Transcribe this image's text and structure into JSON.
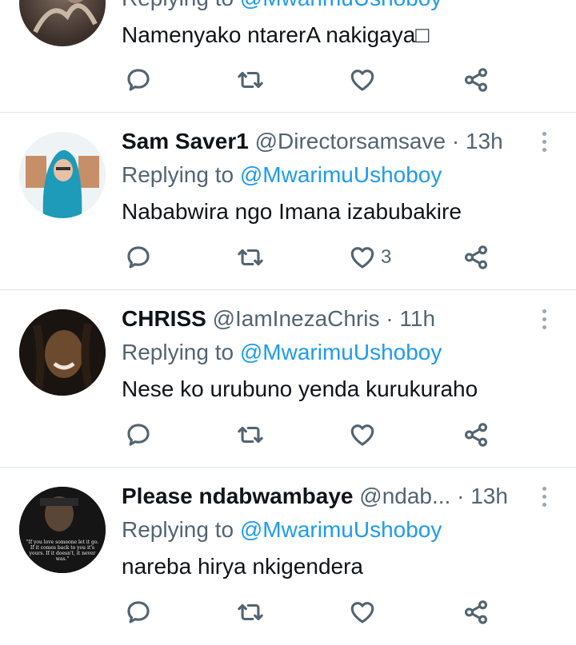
{
  "tweets": [
    {
      "name": "",
      "handle": "",
      "dot": "",
      "time": "",
      "reply_prefix": "Replying to",
      "reply_mention": "@MwarimuUshoboy",
      "text": "Namenyako ntarerA nakigaya□",
      "likes": "",
      "avatar_colors": [
        "#3b2f2a",
        "#7c6a5e"
      ]
    },
    {
      "name": "Sam Saver1",
      "handle": "@Directorsamsave",
      "dot": "·",
      "time": "13h",
      "reply_prefix": "Replying to",
      "reply_mention": "@MwarimuUshoboy",
      "text": "Nababwira ngo Imana izabubakire",
      "likes": "3",
      "avatar_colors": [
        "#e7eef3",
        "#1d9bb8"
      ]
    },
    {
      "name": "CHRISS",
      "handle": "@IamInezaChris",
      "dot": "·",
      "time": "11h",
      "reply_prefix": "Replying to",
      "reply_mention": "@MwarimuUshoboy",
      "text": "Nese ko urubuno yenda kurukuraho",
      "likes": "",
      "avatar_colors": [
        "#1a1410",
        "#6b4a2e"
      ]
    },
    {
      "name": "Please ndabwambaye",
      "handle": "@ndab...",
      "dot": "·",
      "time": "13h",
      "reply_prefix": "Replying to",
      "reply_mention": "@MwarimuUshoboy",
      "text": "nareba hirya nkigendera",
      "likes": "",
      "avatar_quote": "\"If you love someone let it go. If it comes back to you it's yours. If it doesn't, it never was.\"",
      "avatar_colors": [
        "#111111",
        "#3a3a3a"
      ]
    }
  ],
  "icons": [
    "reply-icon",
    "retweet-icon",
    "like-icon",
    "share-icon",
    "more-icon"
  ],
  "colors": {
    "link": "#1d9bf0",
    "muted": "#536471",
    "text": "#0f1419",
    "divider": "#e1e8ed"
  }
}
